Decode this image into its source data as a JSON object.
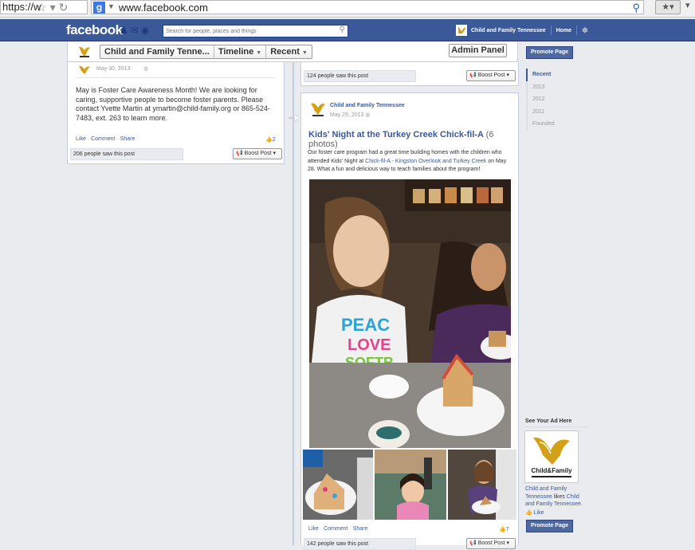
{
  "browser": {
    "left_url_fragment": "https://w",
    "address_url": "www.facebook.com",
    "star_label": "★▾"
  },
  "fb": {
    "logo": "facebook",
    "search_placeholder": "Search for people, places and things",
    "page_name": "Child and Family Tennessee",
    "home_label": "Home"
  },
  "header": {
    "crumb_page": "Child and Family Tenne...",
    "crumb_timeline": "Timeline",
    "crumb_recent": "Recent",
    "admin_panel": "Admin Panel"
  },
  "left_post": {
    "date": "May 30, 2013",
    "body": "May is Foster Care Awareness Month! We are looking for caring, supportive people to become foster parents. Please contact Yvette Martin at ymartin@child-family.org or 865-524-7483, ext. 263 to learn more.",
    "like": "Like",
    "comment": "Comment",
    "share": "Share",
    "likes_count": "2",
    "seen": "206 people saw this post",
    "boost": "Boost Post"
  },
  "right_top": {
    "seen": "124 people saw this post",
    "boost": "Boost Post"
  },
  "right_post": {
    "author": "Child and Family Tennessee",
    "date": "May 29, 2013",
    "title": "Kids' Night at the Turkey Creek Chick-fil-A",
    "photo_count": "(6 photos)",
    "caption_1": "Our foster care program had a great time building homes with the children who attended Kids' Night at ",
    "caption_link": "Chick-fil-A - Kingston Overlook and Turkey Creek",
    "caption_2": " on May 28. What a fun and delicious way to teach families about the program!",
    "like": "Like",
    "comment": "Comment",
    "share": "Share",
    "likes_count": "7",
    "seen": "142 people saw this post",
    "boost": "Boost Post"
  },
  "sidebar": {
    "promote": "Promote Page",
    "years": [
      "Recent",
      "2013",
      "2012",
      "2011",
      "Founded"
    ],
    "ad_title": "See Your Ad Here",
    "ad_name": "Child and Family Tennessee",
    "ad_likes_text": " likes ",
    "ad_target": "Child and Family Tennessee.",
    "ad_like": "Like",
    "promote_bottom": "Promote Page"
  },
  "colors": {
    "fb_blue": "#3b5998",
    "link": "#3b5998"
  }
}
